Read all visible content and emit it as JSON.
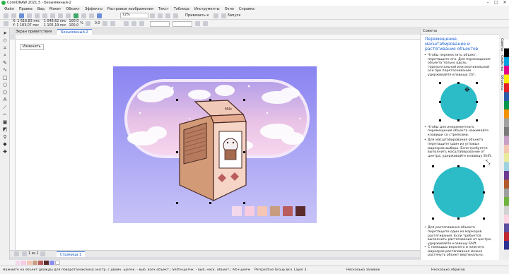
{
  "app": {
    "title": "CorelDRAW 2021.5 - Безымянный-2",
    "window_controls": [
      "–",
      "□",
      "✕"
    ]
  },
  "menu": [
    "Файл",
    "Правка",
    "Вид",
    "Макет",
    "Объект",
    "Эффекты",
    "Растровые изображения",
    "Текст",
    "Таблица",
    "Инструменты",
    "Окно",
    "Справка"
  ],
  "toolbar": {
    "zoom": "72%",
    "snap": "Привязать к",
    "launch": "Запуск"
  },
  "propbar": {
    "x": "X: 1 616,83 пкс",
    "y": "Y: 1 183,07 пкс",
    "w": "1 048,62 пкс",
    "h": "1 105,19 пкс",
    "sx": "100,0",
    "sy": "100,0",
    "pct": "%",
    "angle": "0,0"
  },
  "tabs": [
    {
      "label": "Экран приветствия"
    },
    {
      "label": "Безымянный-2"
    }
  ],
  "canvas": {
    "change_button": "Изменить",
    "box_label": "Milk",
    "swatches": [
      "#f3d8ec",
      "#f7cbe0",
      "#f4c6b3",
      "#c79d82",
      "#b85c5c",
      "#5b2b2b"
    ]
  },
  "hints": {
    "panel_title": "Советы",
    "heading": "Перемещение, масштабирование и растягивание объектов",
    "bullet1": "Чтобы переместить объект, перетащите его. Для перемещения объекта только вдоль горизонтальной или вертикальной оси при перетаскивании удерживайте клавишу Ctrl.",
    "bullet2": "Чтобы для инкрементного перемещения объекта нажимайте клавиши со стрелками.",
    "bullet3": "Для масштабирования объекта перетащите один из угловых маркеров выбора. Если требуется выполнить масштабирование от центра, удерживайте клавишу Shift.",
    "bullet4": "Для растягивания объекта перетащите один из маркеров растягивания. Если требуется выполнить растягивание от центра, удерживайте клавишу Shift.",
    "bullet5": "С помощью верхнего и нижнего маркеров растягивания можно растянуть объект вертикально."
  },
  "dockers": [
    "Советы",
    "Свойства",
    "Объекты"
  ],
  "pagebar": {
    "page_info": "1 из 1",
    "page_tab": "Страница 1"
  },
  "statusbar": {
    "hint": "Нажмите на объект дважды для поворота/наклона; инстр. с двойн. щелчк. - выб. всех объект.; Shift+щелчк. - выб. неск. объект.; Alt+щелчк. - цифры; Ctrl+щелчк. - выб. в группе",
    "selection": "Perspective Group вкл. Layer 3",
    "fill": "Несколько заливок",
    "outline": "Несколько абрисов"
  },
  "colors": {
    "accent": "#1a5ed1",
    "circle": "#2bbcc8",
    "bg_purple": "#8b8df0"
  }
}
